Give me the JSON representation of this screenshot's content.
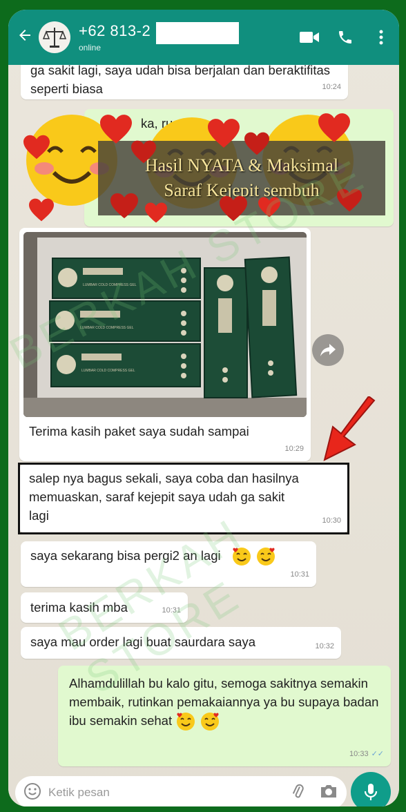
{
  "header": {
    "contact_name": "+62 813-2",
    "status": "online"
  },
  "banner": {
    "line1": "Hasil NYATA & Maksimal",
    "line2": "Saraf Kejepit sembuh"
  },
  "messages": [
    {
      "text": "ga sakit lagi, saya udah bisa berjalan dan beraktifitas seperti biasa",
      "time": "10:24",
      "direction": "in"
    },
    {
      "text": "ka, ru… aka…",
      "time": "",
      "direction": "out"
    },
    {
      "text": "Terima kasih paket saya sudah sampai",
      "time": "10:29",
      "direction": "in"
    },
    {
      "text": "salep nya bagus sekali, saya coba dan hasilnya memuaskan, saraf kejepit saya udah ga sakit lagi",
      "time": "10:30",
      "direction": "in"
    },
    {
      "text": "saya sekarang bisa pergi2 an lagi",
      "time": "10:31",
      "direction": "in"
    },
    {
      "text": "terima kasih mba",
      "time": "10:31",
      "direction": "in"
    },
    {
      "text": "saya mau order lagi buat saurdara saya",
      "time": "10:32",
      "direction": "in"
    },
    {
      "text": "Alhamdulillah bu kalo gitu, semoga sakitnya semakin membaik, rutinkan pemakaiannya ya bu supaya badan ibu semakin sehat",
      "time": "10:33",
      "direction": "out"
    }
  ],
  "product": {
    "label": "LUMBAR COLD COMPRESS GEL"
  },
  "watermark": "BERKAH STORE",
  "input": {
    "placeholder": "Ketik pesan"
  },
  "colors": {
    "header": "#108f7e",
    "outgoing": "#e1f9cf",
    "frame": "#0d6b1c",
    "arrow": "#e8261b"
  },
  "icons": [
    "back-arrow-icon",
    "video-call-icon",
    "phone-icon",
    "more-options-icon",
    "forward-icon",
    "emoji-icon",
    "attach-icon",
    "camera-icon",
    "mic-icon"
  ]
}
